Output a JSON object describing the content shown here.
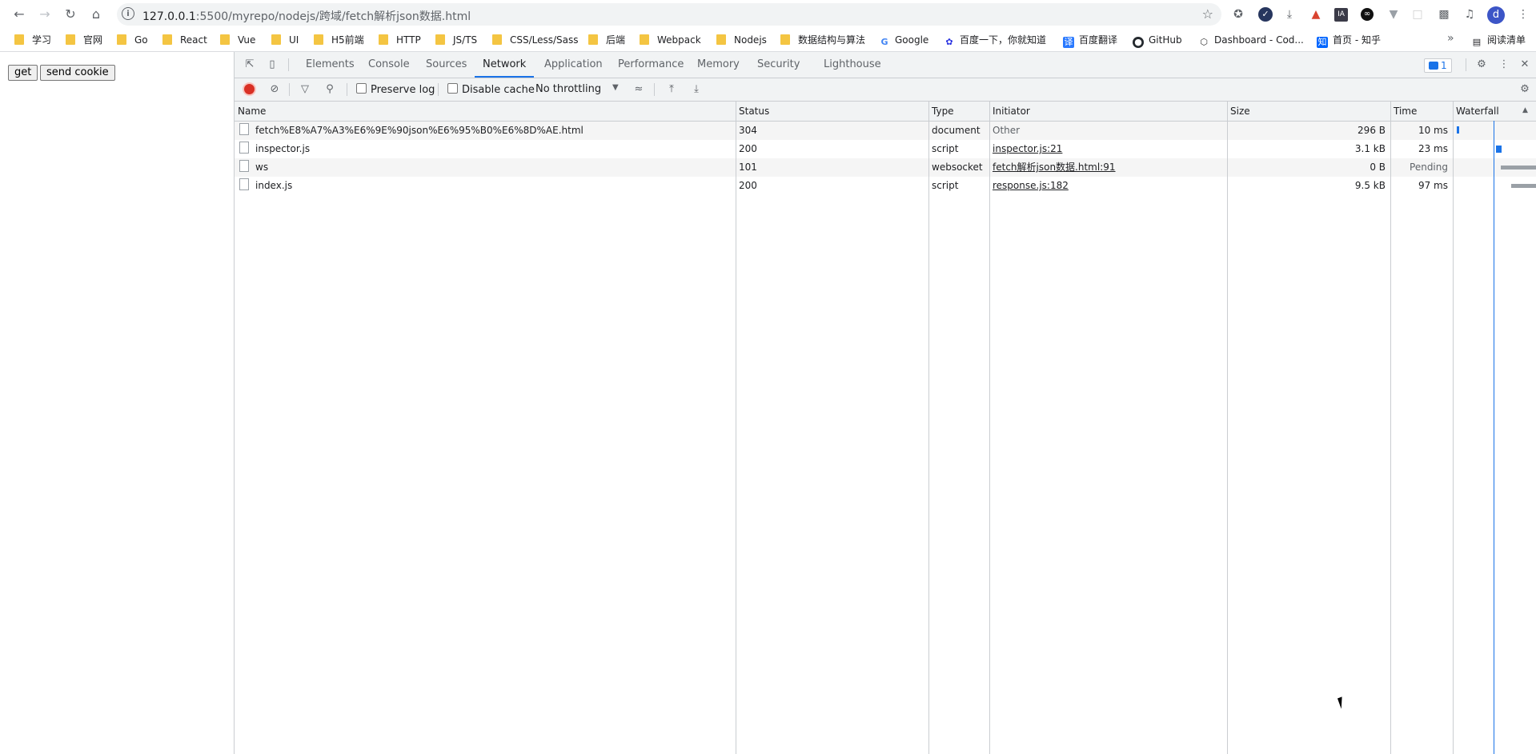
{
  "browser": {
    "url_host": "127.0.0.1",
    "url_rest": ":5500/myrepo/nodejs/跨域/fetch解析json数据.html",
    "profile_initial": "d",
    "extensions": [
      "star-list-icon",
      "dark-circle-icon",
      "download-icon",
      "orange-icon",
      "ia-icon",
      "black-circle-icon",
      "vue-devtools-icon",
      "blank-ext-icon",
      "puzzle-icon",
      "media-icon"
    ],
    "ia_label": "IA"
  },
  "bookmarks": {
    "items": [
      {
        "label": "学习",
        "icon": "folder"
      },
      {
        "label": "官网",
        "icon": "folder"
      },
      {
        "label": "Go",
        "icon": "folder"
      },
      {
        "label": "React",
        "icon": "folder"
      },
      {
        "label": "Vue",
        "icon": "folder"
      },
      {
        "label": "UI",
        "icon": "folder"
      },
      {
        "label": "H5前端",
        "icon": "folder"
      },
      {
        "label": "HTTP",
        "icon": "folder"
      },
      {
        "label": "JS/TS",
        "icon": "folder"
      },
      {
        "label": "CSS/Less/Sass",
        "icon": "folder"
      },
      {
        "label": "后端",
        "icon": "folder"
      },
      {
        "label": "Webpack",
        "icon": "folder"
      },
      {
        "label": "Nodejs",
        "icon": "folder"
      },
      {
        "label": "数据结构与算法",
        "icon": "folder"
      },
      {
        "label": "Google",
        "icon": "google"
      },
      {
        "label": "百度一下，你就知道",
        "icon": "baidu"
      },
      {
        "label": "百度翻译",
        "icon": "translate"
      },
      {
        "label": "GitHub",
        "icon": "github"
      },
      {
        "label": "Dashboard - Cod...",
        "icon": "codepen"
      },
      {
        "label": "首页 - 知乎",
        "icon": "zhihu"
      }
    ],
    "more": "»",
    "reader_mode": "阅读清单"
  },
  "page": {
    "buttons": [
      "get",
      "send cookie"
    ]
  },
  "devtools": {
    "tabs": [
      "Elements",
      "Console",
      "Sources",
      "Network",
      "Application",
      "Performance",
      "Memory",
      "Security",
      "Lighthouse"
    ],
    "active_tab": "Network",
    "issues_count": "1",
    "toolbar": {
      "preserve_log": "Preserve log",
      "disable_cache": "Disable cache",
      "throttling": "No throttling"
    },
    "columns": [
      "Name",
      "Status",
      "Type",
      "Initiator",
      "Size",
      "Time",
      "Waterfall"
    ],
    "requests": [
      {
        "name": "fetch%E8%A7%A3%E6%9E%90json%E6%95%B0%E6%8D%AE.html",
        "status": "304",
        "type": "document",
        "initiator": "Other",
        "initiator_link": false,
        "size": "296 B",
        "time": "10 ms"
      },
      {
        "name": "inspector.js",
        "status": "200",
        "type": "script",
        "initiator": "inspector.js:21",
        "initiator_link": true,
        "size": "3.1 kB",
        "time": "23 ms"
      },
      {
        "name": "ws",
        "status": "101",
        "type": "websocket",
        "initiator": "fetch解析json数据.html:91",
        "initiator_link": true,
        "size": "0 B",
        "time": "Pending"
      },
      {
        "name": "index.js",
        "status": "200",
        "type": "script",
        "initiator": "response.js:182",
        "initiator_link": true,
        "size": "9.5 kB",
        "time": "97 ms"
      }
    ],
    "waterfall_colors": {
      "request": "#1a73e8",
      "pending": "#9aa0a6"
    }
  }
}
